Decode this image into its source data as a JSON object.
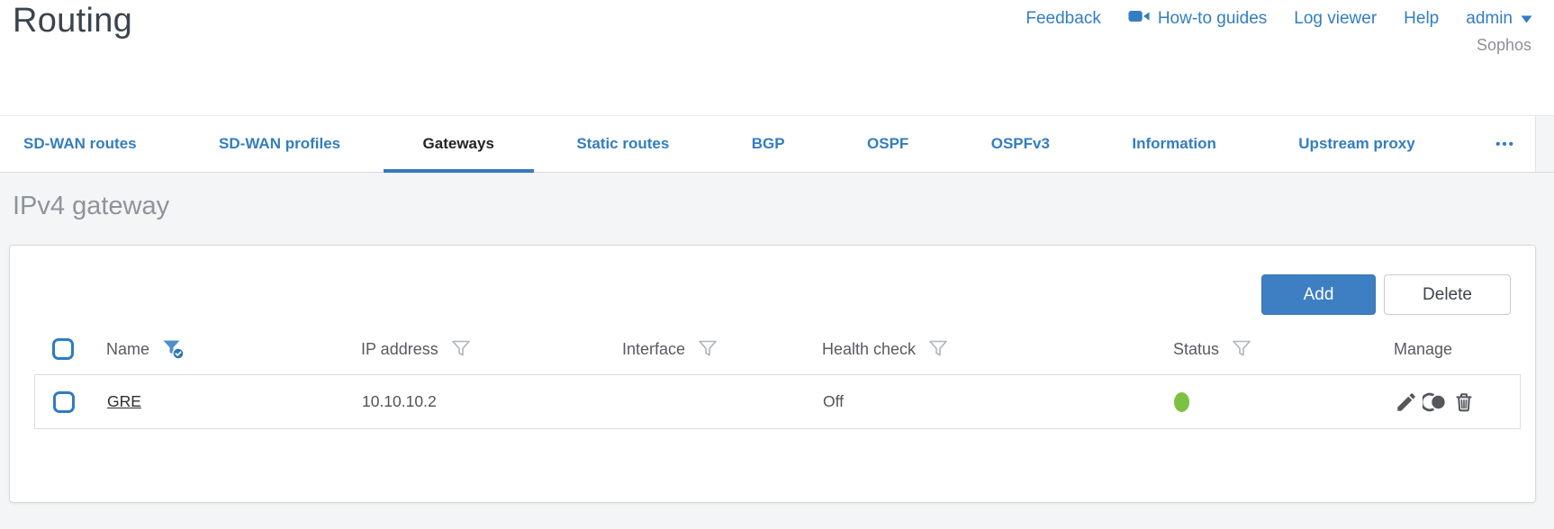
{
  "header": {
    "title": "Routing",
    "nav": {
      "feedback": "Feedback",
      "howto_guides": "How-to guides",
      "log_viewer": "Log viewer",
      "help": "Help",
      "user": "admin",
      "brand": "Sophos"
    }
  },
  "tabs": {
    "items": [
      "SD-WAN routes",
      "SD-WAN profiles",
      "Gateways",
      "Static routes",
      "BGP",
      "OSPF",
      "OSPFv3",
      "Information",
      "Upstream proxy"
    ],
    "active": "Gateways",
    "overflow": "•••"
  },
  "content": {
    "section_title": "IPv4 gateway",
    "toolbar": {
      "add": "Add",
      "delete": "Delete"
    },
    "table": {
      "columns": {
        "name": "Name",
        "ip": "IP address",
        "interface": "Interface",
        "health": "Health check",
        "status": "Status",
        "manage": "Manage"
      },
      "filters": {
        "name": "active",
        "ip": "inactive",
        "interface": "inactive",
        "health": "inactive",
        "status": "inactive"
      },
      "rows": [
        {
          "name": "GRE",
          "ip": "10.10.10.2",
          "interface": "",
          "health": "Off",
          "status": "up",
          "actions": [
            "edit-icon",
            "clone-icon",
            "delete-icon"
          ]
        }
      ]
    }
  },
  "colors": {
    "accent_blue": "#337dc1",
    "active_tab_underline": "#3879bd",
    "status_green": "#7cc140",
    "add_button": "#3e7ec3"
  }
}
